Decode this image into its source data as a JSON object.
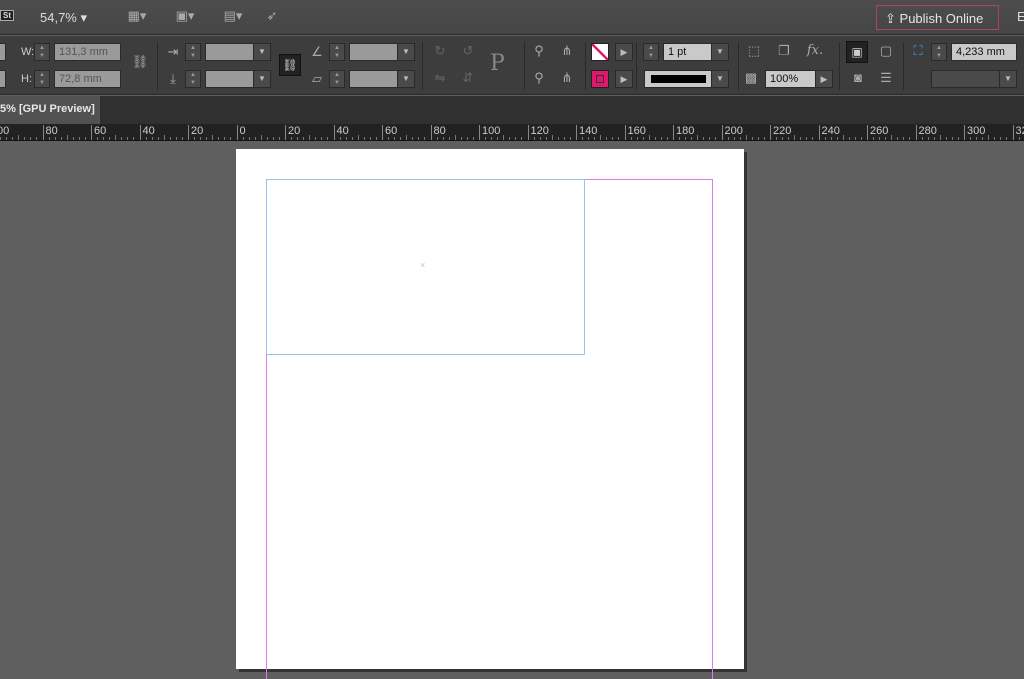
{
  "appbar": {
    "stock_badge": "St",
    "zoom": "54,7%",
    "publish_label": "Publish Online",
    "edge_label": "E"
  },
  "control": {
    "w_label": "W:",
    "w_value": "131,3 mm",
    "h_label": "H:",
    "h_value": "72,8 mm",
    "stroke_weight": "1 pt",
    "opacity": "100%",
    "offset": "4,233 mm",
    "ref_point": "P"
  },
  "tab": {
    "label": "5% [GPU Preview]"
  },
  "ruler": {
    "labels": [
      "00",
      "80",
      "60",
      "40",
      "20",
      "0",
      "20",
      "40",
      "60",
      "80",
      "100",
      "120",
      "140",
      "160",
      "180",
      "200",
      "220",
      "240",
      "260",
      "280",
      "300",
      "32"
    ]
  },
  "colors": {
    "accent": "#e0186c",
    "margin": "#d97cf0",
    "frame": "#9cc2ee"
  }
}
